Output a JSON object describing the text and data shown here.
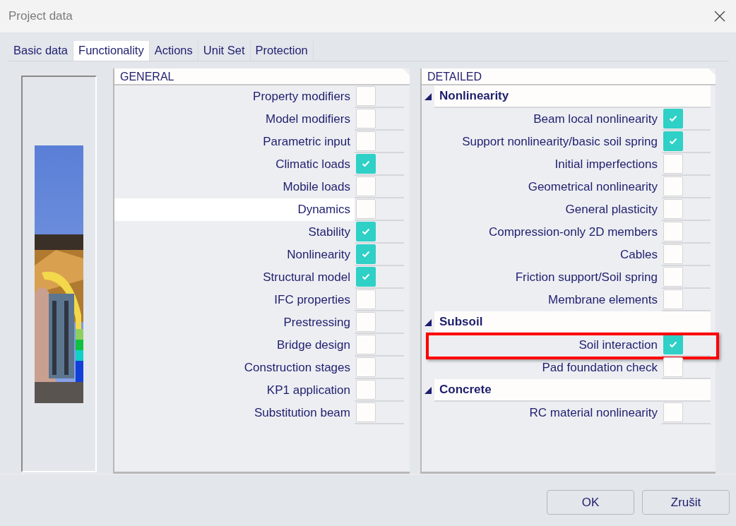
{
  "window": {
    "title": "Project data"
  },
  "tabs": [
    {
      "label": "Basic data",
      "selected": false
    },
    {
      "label": "Functionality",
      "selected": true
    },
    {
      "label": "Actions",
      "selected": false
    },
    {
      "label": "Unit Set",
      "selected": false
    },
    {
      "label": "Protection",
      "selected": false
    }
  ],
  "preview": {
    "kind": "picture"
  },
  "general": {
    "title": "GENERAL",
    "items": [
      {
        "label": "Property modifiers",
        "checked": false,
        "selected": false
      },
      {
        "label": "Model modifiers",
        "checked": false,
        "selected": false
      },
      {
        "label": "Parametric input",
        "checked": false,
        "selected": false
      },
      {
        "label": "Climatic loads",
        "checked": true,
        "selected": false
      },
      {
        "label": "Mobile loads",
        "checked": false,
        "selected": false
      },
      {
        "label": "Dynamics",
        "checked": false,
        "selected": true
      },
      {
        "label": "Stability",
        "checked": true,
        "selected": false
      },
      {
        "label": "Nonlinearity",
        "checked": true,
        "selected": false
      },
      {
        "label": "Structural model",
        "checked": true,
        "selected": false
      },
      {
        "label": "IFC properties",
        "checked": false,
        "selected": false
      },
      {
        "label": "Prestressing",
        "checked": false,
        "selected": false
      },
      {
        "label": "Bridge design",
        "checked": false,
        "selected": false
      },
      {
        "label": "Construction stages",
        "checked": false,
        "selected": false
      },
      {
        "label": "KP1 application",
        "checked": false,
        "selected": false
      },
      {
        "label": "Substitution beam",
        "checked": false,
        "selected": false
      }
    ]
  },
  "detailed": {
    "title": "DETAILED",
    "groups": [
      {
        "label": "Nonlinearity",
        "expanded": true,
        "children": [
          {
            "label": "Beam local nonlinearity",
            "checked": true,
            "highlighted": false
          },
          {
            "label": "Support nonlinearity/basic soil spring",
            "checked": true,
            "highlighted": false
          },
          {
            "label": "Initial imperfections",
            "checked": false,
            "highlighted": false
          },
          {
            "label": "Geometrical nonlinearity",
            "checked": false,
            "highlighted": false
          },
          {
            "label": "General plasticity",
            "checked": false,
            "highlighted": false
          },
          {
            "label": "Compression-only 2D members",
            "checked": false,
            "highlighted": false
          },
          {
            "label": "Cables",
            "checked": false,
            "highlighted": false
          },
          {
            "label": "Friction support/Soil spring",
            "checked": false,
            "highlighted": false
          },
          {
            "label": "Membrane elements",
            "checked": false,
            "highlighted": false
          }
        ]
      },
      {
        "label": "Subsoil",
        "expanded": true,
        "children": [
          {
            "label": "Soil interaction",
            "checked": true,
            "highlighted": true
          },
          {
            "label": "Pad foundation check",
            "checked": false,
            "highlighted": false
          }
        ]
      },
      {
        "label": "Concrete",
        "expanded": true,
        "children": [
          {
            "label": "RC material nonlinearity",
            "checked": false,
            "highlighted": false
          }
        ]
      }
    ]
  },
  "buttons": [
    "OK",
    "Zrušit"
  ]
}
